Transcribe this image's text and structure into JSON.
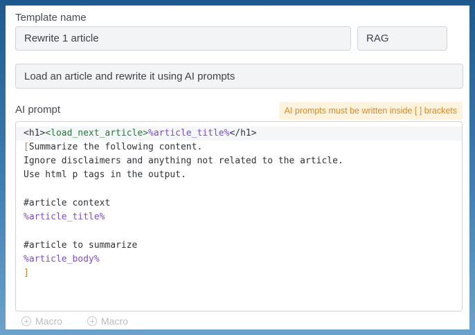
{
  "template_name": {
    "label": "Template name",
    "value": "Rewrite 1 article",
    "tag_value": "RAG"
  },
  "description": {
    "value": "Load an article and rewrite it using AI prompts"
  },
  "ai_prompt": {
    "label": "AI prompt",
    "hint": "AI prompts must be written inside [ ] brackets",
    "lines": {
      "l1_open_h1": "<h1>",
      "l1_load": "<load_next_article>",
      "l1_var": "%article_title%",
      "l1_close_h1": "</h1>",
      "l2_bracket": "[",
      "l2_text": "Summarize the following content.",
      "l3": "Ignore disclaimers and anything not related to the article.",
      "l4": "Use html p tags in the output.",
      "l6": "#article context",
      "l7": "%article_title%",
      "l9": "#article to summarize",
      "l10": "%article_body%",
      "l11": "]"
    }
  },
  "macros": [
    {
      "label": "Macro",
      "icon": "plus-circle-icon"
    },
    {
      "label": "Macro",
      "icon": "plus-circle-icon"
    }
  ],
  "colors": {
    "hint_bg": "#fdf2dc",
    "hint_text": "#d98a1f",
    "tag_color": "#1f7a3a",
    "variable_color": "#7b4bd1",
    "bracket_color": "#d47a1e"
  }
}
